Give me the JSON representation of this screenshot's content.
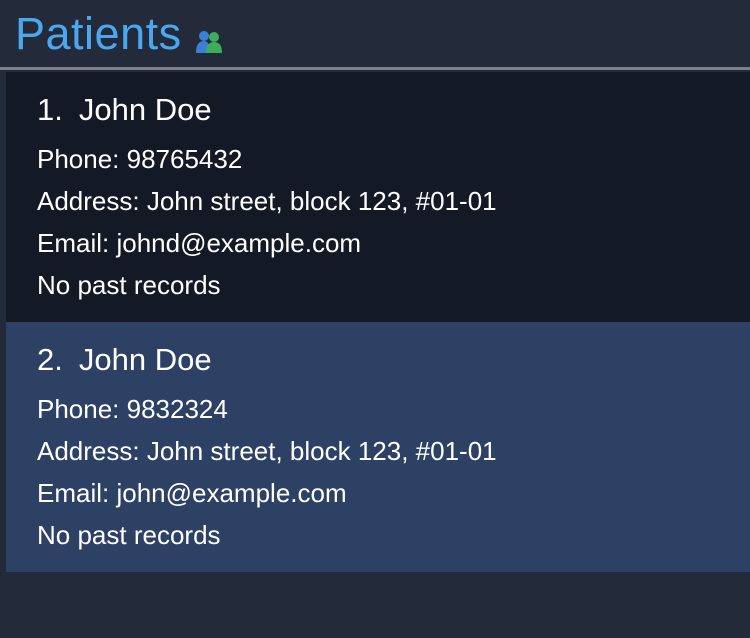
{
  "panel": {
    "title": "Patients",
    "title_icon": "people-icon",
    "accent_color": "#4aa8f0"
  },
  "patients": [
    {
      "index": "1.",
      "name": "John Doe",
      "phone": "Phone: 98765432",
      "address": "Address: John street, block 123, #01-01",
      "email": "Email: johnd@example.com",
      "records": "No past records",
      "selected": false
    },
    {
      "index": "2.",
      "name": "John Doe",
      "phone": "Phone: 9832324",
      "address": "Address: John street, block 123, #01-01",
      "email": "Email: john@example.com",
      "records": "No past records",
      "selected": true
    }
  ]
}
